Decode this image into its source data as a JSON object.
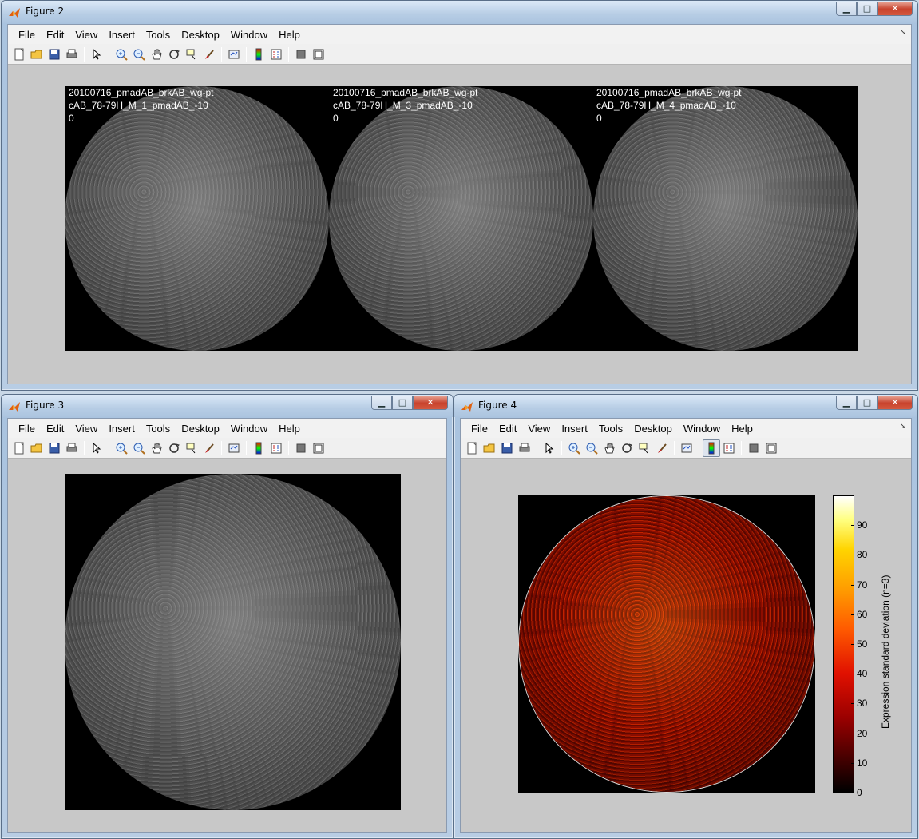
{
  "figure2": {
    "title": "Figure 2",
    "menu": [
      "File",
      "Edit",
      "View",
      "Insert",
      "Tools",
      "Desktop",
      "Window",
      "Help"
    ],
    "images": [
      {
        "line1": "20100716_pmadAB_brkAB_wg-pt",
        "line2": "cAB_78-79H_M_1_pmadAB_-10",
        "line3": "0"
      },
      {
        "line1": "20100716_pmadAB_brkAB_wg-pt",
        "line2": "cAB_78-79H_M_3_pmadAB_-10",
        "line3": "0"
      },
      {
        "line1": "20100716_pmadAB_brkAB_wg-pt",
        "line2": "cAB_78-79H_M_4_pmadAB_-10",
        "line3": "0"
      }
    ]
  },
  "figure3": {
    "title": "Figure 3",
    "menu": [
      "File",
      "Edit",
      "View",
      "Insert",
      "Tools",
      "Desktop",
      "Window",
      "Help"
    ]
  },
  "figure4": {
    "title": "Figure 4",
    "menu": [
      "File",
      "Edit",
      "View",
      "Insert",
      "Tools",
      "Desktop",
      "Window",
      "Help"
    ],
    "colorbar": {
      "label": "Expression standard deviation (n=3)",
      "ticks": [
        "0",
        "10",
        "20",
        "30",
        "40",
        "50",
        "60",
        "70",
        "80",
        "90"
      ],
      "colormap": "hot"
    }
  },
  "toolbar_icons": [
    "new-figure-icon",
    "open-icon",
    "save-icon",
    "print-icon",
    "edit-plot-icon",
    "zoom-in-icon",
    "zoom-out-icon",
    "pan-icon",
    "rotate-3d-icon",
    "data-cursor-icon",
    "brush-icon",
    "link-plot-icon",
    "colorbar-icon",
    "legend-icon",
    "hide-plot-tools-icon",
    "show-plot-tools-icon"
  ]
}
